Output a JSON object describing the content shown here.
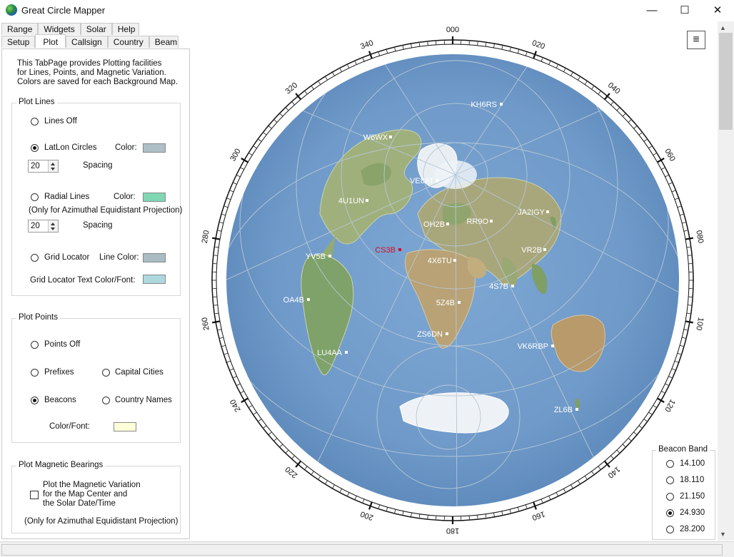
{
  "window": {
    "title": "Great Circle Mapper",
    "min_icon": "minimize-icon",
    "max_icon": "maximize-icon",
    "close_icon": "close-icon"
  },
  "tabs_row1": [
    "Range",
    "Widgets",
    "Solar",
    "Help"
  ],
  "tabs_row2": [
    "Setup",
    "Plot",
    "Callsign",
    "Country",
    "Beam"
  ],
  "active_tab": "Plot",
  "intro": [
    "This TabPage provides Plotting facilities",
    "for Lines, Points, and Magnetic Variation.",
    "Colors are saved for each Background Map."
  ],
  "plot_lines": {
    "title": "Plot Lines",
    "lines_off": "Lines Off",
    "latlon": "LatLon Circles",
    "latlon_color_label": "Color:",
    "latlon_color": "#aebfc6",
    "latlon_spacing": "20",
    "spacing_label": "Spacing",
    "radial": "Radial Lines",
    "radial_color_label": "Color:",
    "radial_color": "#7fd7b4",
    "radial_note": "(Only for Azimuthal Equidistant Projection)",
    "radial_spacing": "20",
    "grid": "Grid Locator",
    "grid_line_color_label": "Line Color:",
    "grid_line_color": "#a9bcc4",
    "grid_text_label": "Grid Locator  Text Color/Font:",
    "grid_text_color": "#add8de"
  },
  "plot_points": {
    "title": "Plot Points",
    "points_off": "Points Off",
    "prefixes": "Prefixes",
    "capitals": "Capital Cities",
    "beacons": "Beacons",
    "country_names": "Country Names",
    "color_font_label": "Color/Font:",
    "color_font": "#ffffd9"
  },
  "magnetic": {
    "title": "Plot Magnetic Bearings",
    "desc": [
      "Plot the Magnetic Variation",
      "for the Map Center and",
      "the Solar Date/Time"
    ],
    "note": "(Only for Azimuthal Equidistant Projection)"
  },
  "menu_button": "≡",
  "bearings": [
    "000",
    "020",
    "040",
    "060",
    "080",
    "100",
    "120",
    "140",
    "160",
    "180",
    "200",
    "220",
    "240",
    "260",
    "280",
    "300",
    "320",
    "340"
  ],
  "beacons": [
    {
      "label": "KH6RS"
    },
    {
      "label": "W6WX"
    },
    {
      "label": "VE8AT"
    },
    {
      "label": "4U1UN"
    },
    {
      "label": "JA2IGY"
    },
    {
      "label": "OH2B"
    },
    {
      "label": "RR9O"
    },
    {
      "label": "CS3B"
    },
    {
      "label": "VR2B"
    },
    {
      "label": "YV5B"
    },
    {
      "label": "4X6TU"
    },
    {
      "label": "4S7B"
    },
    {
      "label": "OA4B"
    },
    {
      "label": "5Z4B"
    },
    {
      "label": "ZS6DN"
    },
    {
      "label": "VK6RBP"
    },
    {
      "label": "LU4AA"
    },
    {
      "label": "ZL6B"
    }
  ],
  "beacon_band": {
    "title": "Beacon Band",
    "options": [
      "14.100",
      "18.110",
      "21.150",
      "24.930",
      "28.200"
    ],
    "selected": "24.930"
  },
  "colors": {
    "beacon": "#ffffff",
    "beacon_highlight": "#d0102a",
    "ocean": "#6f9ac9"
  }
}
